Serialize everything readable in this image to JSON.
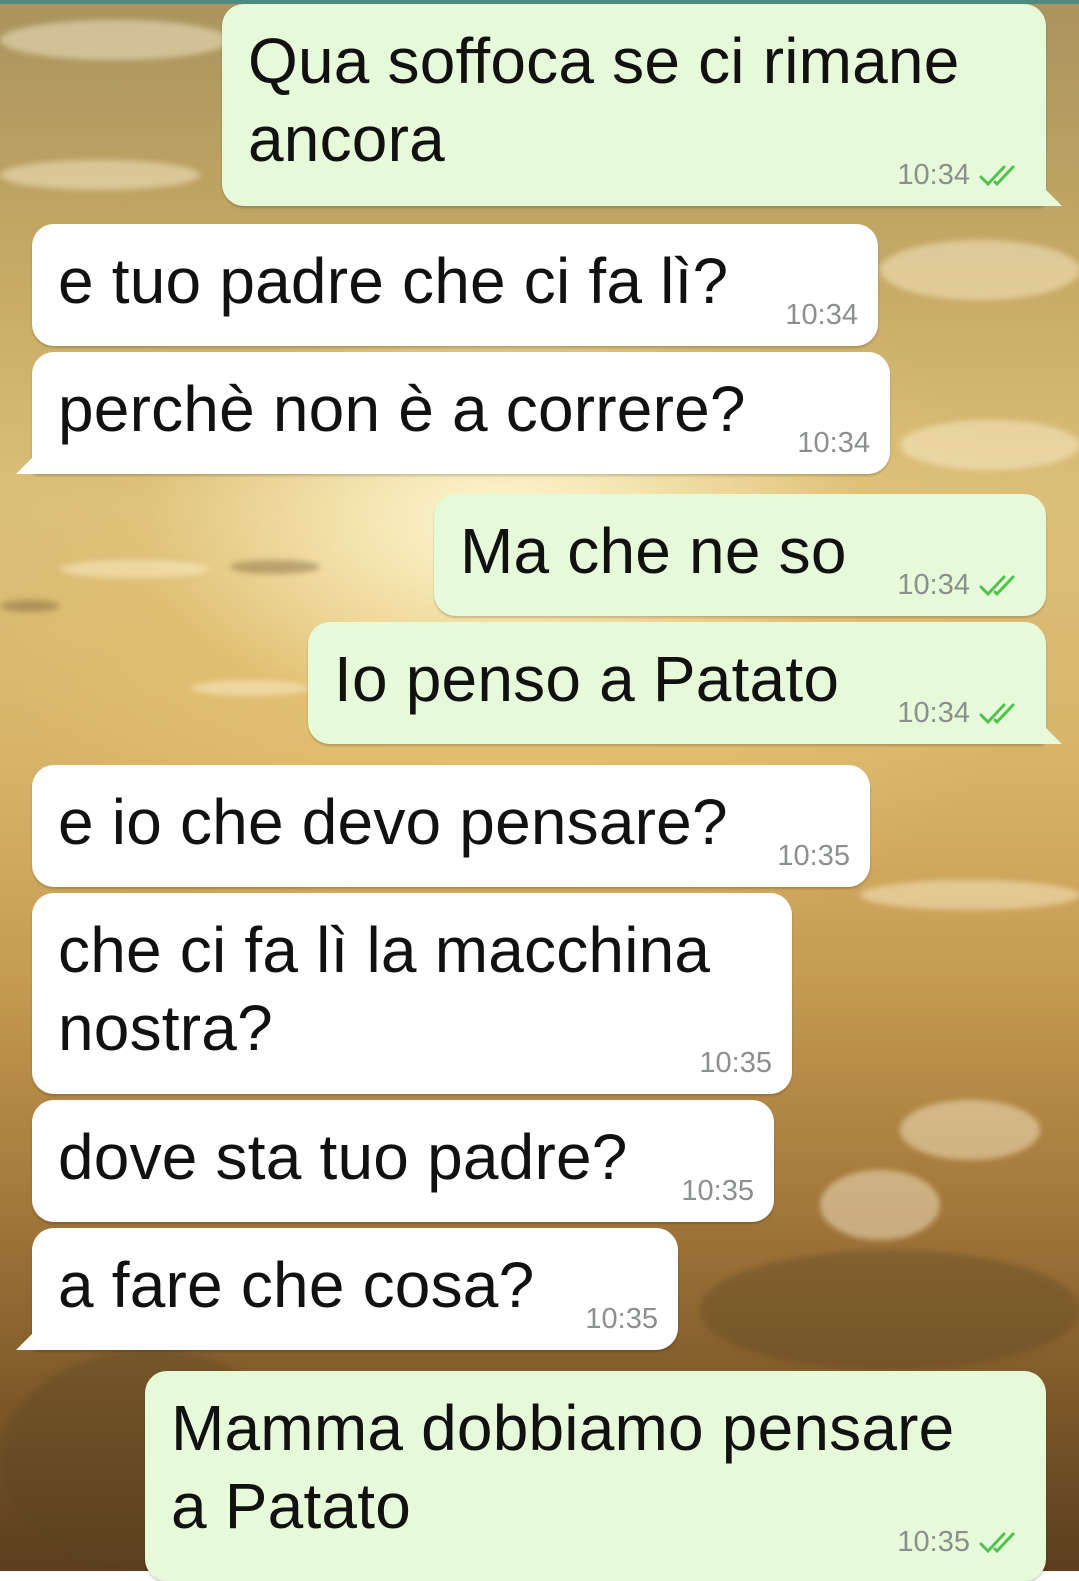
{
  "colors": {
    "incoming_bubble": "#ffffff",
    "outgoing_bubble": "#e6f9d8",
    "read_ticks": "#4fc24f",
    "time_text": "#8b8f8e"
  },
  "messages": [
    {
      "direction": "out",
      "text": "Qua soffoca se ci rimane\nancora",
      "time": "10:34",
      "status": "read-ticks-icon"
    },
    {
      "direction": "in",
      "text": "e tuo padre che ci fa lì?",
      "time": "10:34"
    },
    {
      "direction": "in",
      "text": "perchè non è a correre?",
      "time": "10:34"
    },
    {
      "direction": "out",
      "text": "Ma che ne so",
      "time": "10:34",
      "status": "read-ticks-icon"
    },
    {
      "direction": "out",
      "text": "Io penso a Patato",
      "time": "10:34",
      "status": "read-ticks-icon"
    },
    {
      "direction": "in",
      "text": "e io che devo pensare?",
      "time": "10:35"
    },
    {
      "direction": "in",
      "text": "che ci fa lì la macchina\nnostra?",
      "time": "10:35"
    },
    {
      "direction": "in",
      "text": "dove sta tuo padre?",
      "time": "10:35"
    },
    {
      "direction": "in",
      "text": "a fare che cosa?",
      "time": "10:35"
    },
    {
      "direction": "out",
      "text": "Mamma dobbiamo pensare\na Patato",
      "time": "10:35",
      "status": "read-ticks-icon"
    }
  ]
}
